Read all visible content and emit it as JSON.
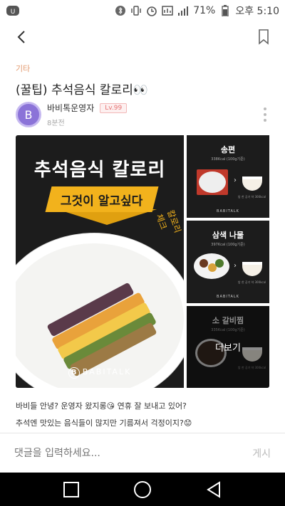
{
  "status_bar": {
    "battery_percent": "71%",
    "time": "오후 5:10"
  },
  "header": {
    "back_icon": "chevron-left-icon",
    "bookmark_icon": "bookmark-icon"
  },
  "post": {
    "category": "기타",
    "title": "(꿀팁) 추석음식 칼로리👀",
    "author": {
      "avatar_letter": "B",
      "name": "바비톡운영자",
      "level": "Lv.99",
      "time_ago": "8분전"
    },
    "gallery": {
      "main": {
        "headline": "추석음식 칼로리",
        "banner": "그것이 알고싶다",
        "script_text": "칼로리 체크",
        "brand": "BABITALK"
      },
      "side": [
        {
          "title": "송편",
          "kcal": "338Kcal (100g기준)",
          "rice_note": "밥 한 공기 약 300kcal",
          "brand": "BABITALK"
        },
        {
          "title": "삼색 나물",
          "kcal": "397Kcal (100g기준)",
          "rice_note": "밥 한 공기 약 300kcal",
          "brand": "BABITALK"
        },
        {
          "title": "소 갈비찜",
          "kcal": "335Kcal (100g기준)",
          "rice_note": "밥 한 공기 약 300kcal",
          "brand": ""
        }
      ],
      "more_label": "더보기"
    },
    "body_lines": [
      "바비들 안녕? 운영자 왔지롱😘 연휴 잘 보내고 있어?",
      "추석엔 맛있는 음식들이 많지만 기름져서 걱정이지?😟"
    ]
  },
  "comment": {
    "placeholder": "댓글을 입력하세요...",
    "submit_label": "게시"
  }
}
